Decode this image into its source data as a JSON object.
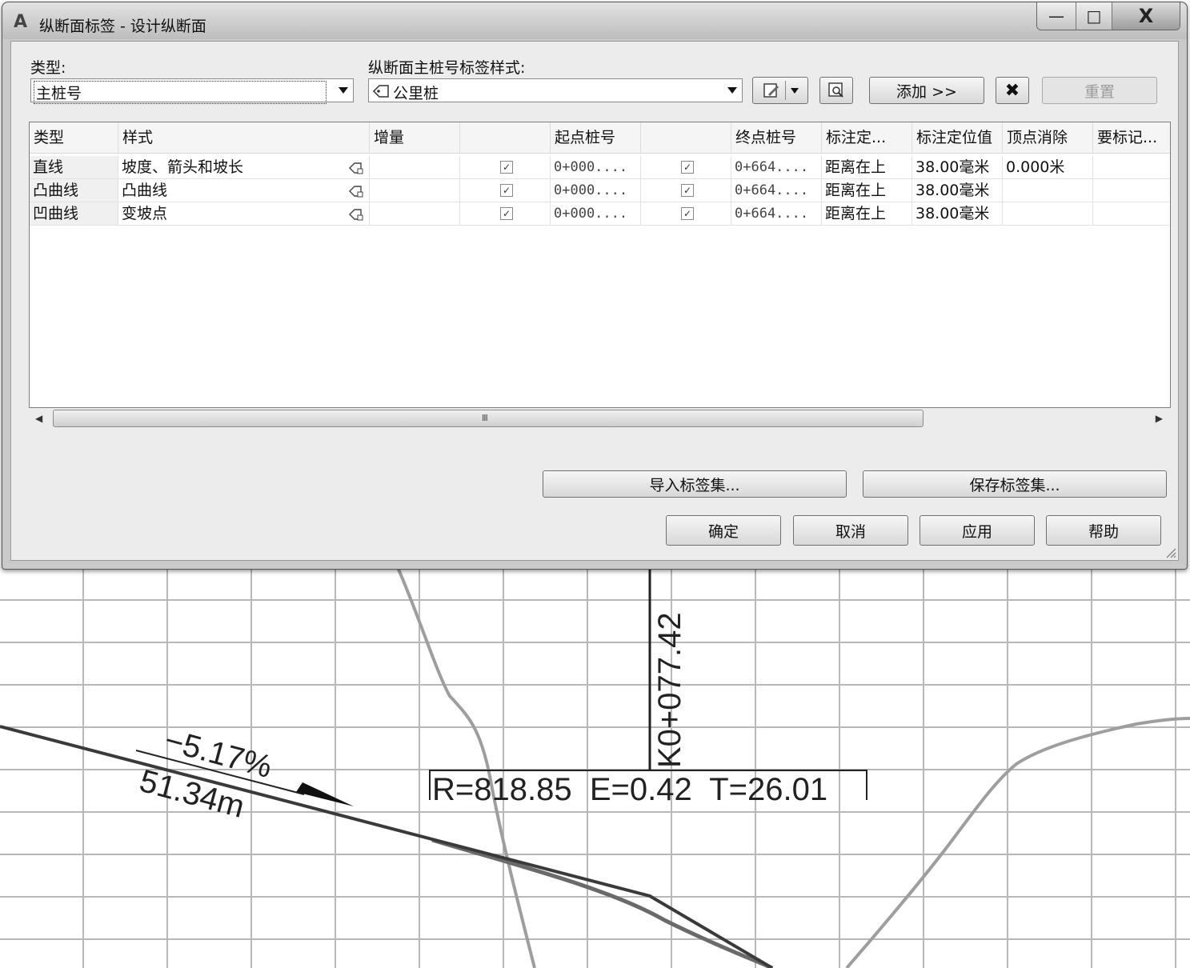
{
  "window": {
    "title": "纵断面标签 - 设计纵断面",
    "app_logo": "A",
    "minimize_glyph": "—",
    "maximize_glyph": "□",
    "close_glyph": "X"
  },
  "type_field": {
    "label": "类型:",
    "value": "主桩号"
  },
  "style_field": {
    "label": "纵断面主桩号标签样式:",
    "value": "公里桩"
  },
  "toolbar": {
    "add_label": "添加 >>",
    "reset_label": "重置",
    "delete_glyph": "✖"
  },
  "grid": {
    "columns": [
      "类型",
      "样式",
      "增量",
      "",
      "起点桩号",
      "",
      "终点桩号",
      "标注定...",
      "标注定位值",
      "顶点消除",
      "要标记..."
    ],
    "rows": [
      {
        "type": "直线",
        "style": "坡度、箭头和坡长",
        "increment": "",
        "start_checked": true,
        "start": "0+000....",
        "end_checked": true,
        "end": "0+664....",
        "anchor": "距离在上",
        "anchor_value": "38.00毫米",
        "vertex_clear": "0.000米",
        "mark": ""
      },
      {
        "type": "凸曲线",
        "style": "凸曲线",
        "increment": "",
        "start_checked": true,
        "start": "0+000....",
        "end_checked": true,
        "end": "0+664....",
        "anchor": "距离在上",
        "anchor_value": "38.00毫米",
        "vertex_clear": "",
        "mark": ""
      },
      {
        "type": "凹曲线",
        "style": "变坡点",
        "increment": "",
        "start_checked": true,
        "start": "0+000....",
        "end_checked": true,
        "end": "0+664....",
        "anchor": "距离在上",
        "anchor_value": "38.00毫米",
        "vertex_clear": "",
        "mark": ""
      }
    ]
  },
  "scrollbar": {
    "grip": "III"
  },
  "buttons": {
    "import": "导入标签集...",
    "save": "保存标签集...",
    "ok": "确定",
    "cancel": "取消",
    "apply": "应用",
    "help": "帮助"
  },
  "drawing": {
    "station_label": "K0+077.42",
    "curve_label": "R=818.85  E=0.42  T=26.01",
    "grade_label": "−5.17%",
    "length_label": "51.34m"
  }
}
